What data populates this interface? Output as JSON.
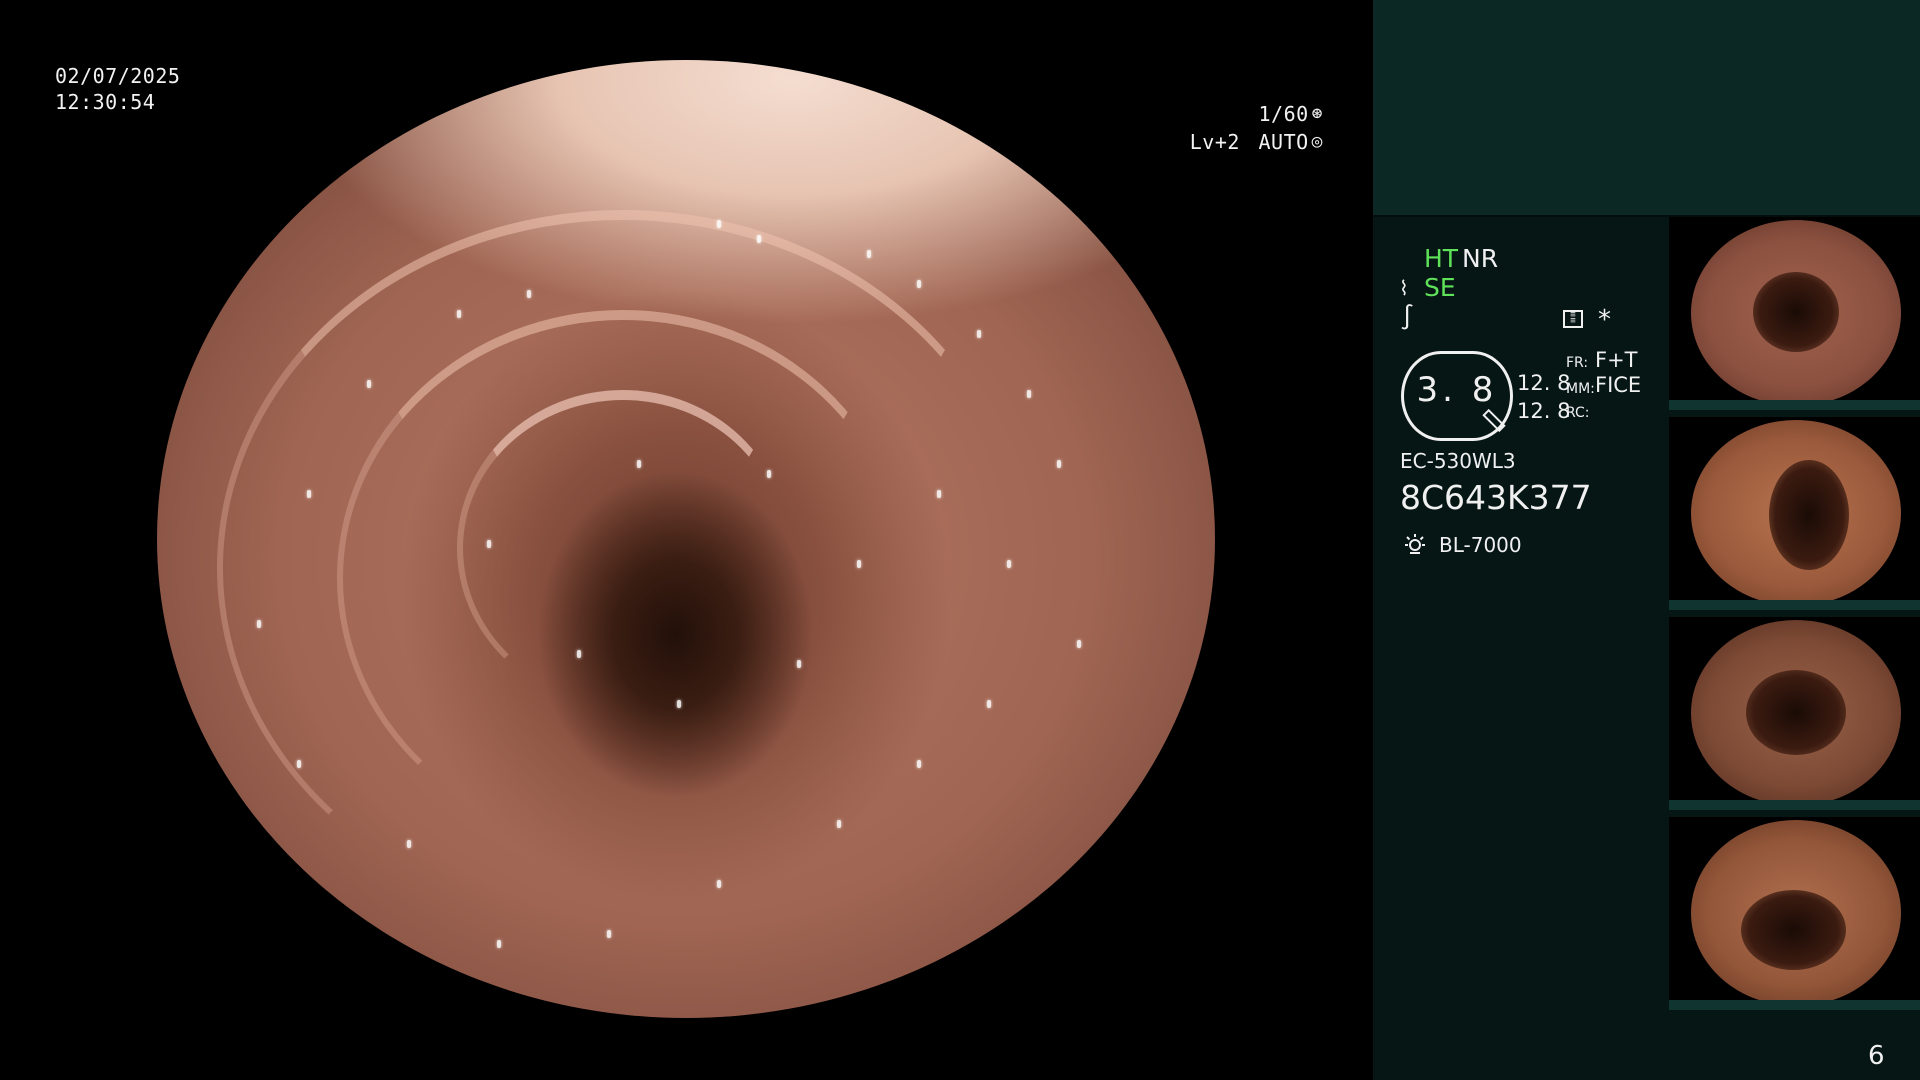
{
  "overlay": {
    "date": "02/07/2025",
    "time": "12:30:54",
    "shutter": "1/60",
    "shutter_icon": "aperture-icon",
    "level": "Lv+2",
    "mode": "AUTO",
    "mode_icon": "iris-icon"
  },
  "panel": {
    "indicators": {
      "ht": "HT",
      "nr": "NR",
      "se": "SE",
      "ht_color": "#5fe25a",
      "se_color": "#5fe25a"
    },
    "star": "*",
    "zoom_value": "3. 8",
    "stat_1": "12. 8",
    "stat_2": "12. 8",
    "fr_label": "FR:",
    "fr_value": "F+T",
    "mm_label": "MM:",
    "mm_value": "FICE",
    "rc_label": "RC:",
    "scope_model": "EC-530WL3",
    "scope_serial": "8C643K377",
    "light_source": "BL-7000",
    "page_number": "6"
  },
  "thumbnails": [
    "captured-frame-1",
    "captured-frame-2",
    "captured-frame-3",
    "captured-frame-4"
  ],
  "colors": {
    "panel_top": "#0b2825",
    "panel_bottom": "#051614",
    "indicator_green": "#5fe25a"
  }
}
